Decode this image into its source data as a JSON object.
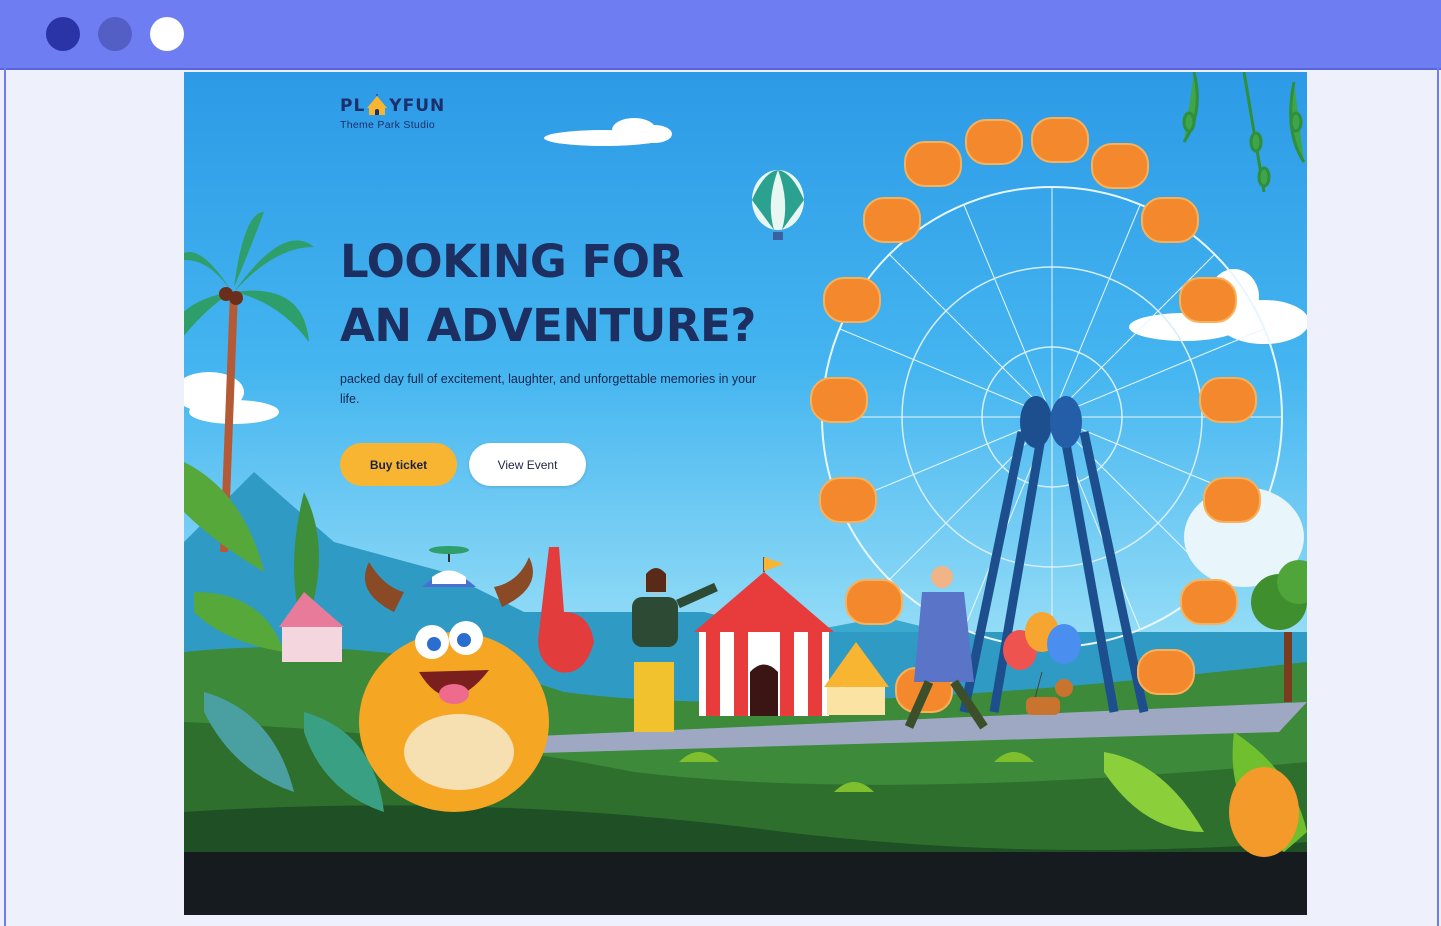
{
  "window": {
    "controls": [
      "window-dot-dark",
      "window-dot-medium",
      "window-dot-light"
    ]
  },
  "brand": {
    "logo_left": "PL",
    "logo_right": "YFUN",
    "subtitle": "Theme Park Studio"
  },
  "hero": {
    "headline_line1": "LOOKING FOR",
    "headline_line2": "AN ADVENTURE?",
    "tagline": "packed day full of excitement, laughter, and unforgettable memories in your life.",
    "primary_button": "Buy ticket",
    "secondary_button": "View Event"
  },
  "colors": {
    "window_bar": "#6e7df2",
    "accent_yellow": "#f7b531",
    "headline_navy": "#1c2f60",
    "sky_blue": "#2c9ae6"
  }
}
